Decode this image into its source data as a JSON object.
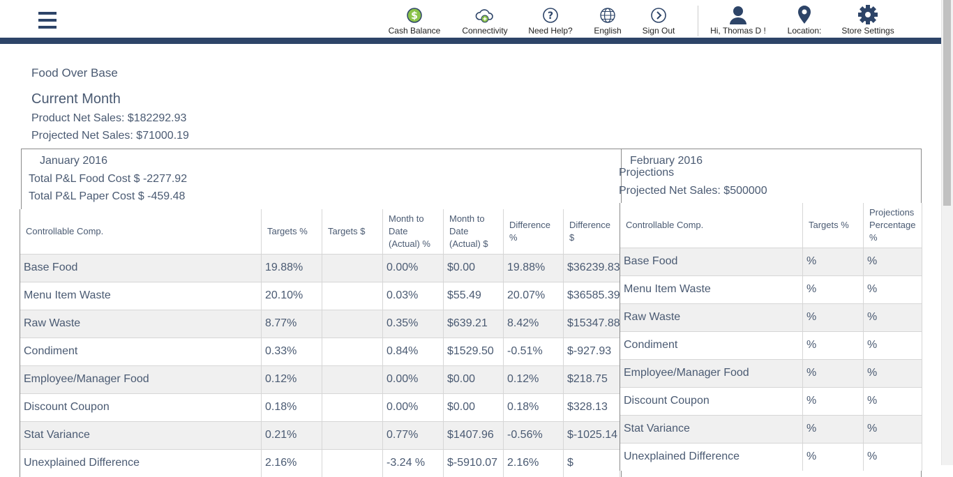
{
  "header": {
    "nav": [
      {
        "label": "Cash Balance",
        "icon": "dollar-circle-icon"
      },
      {
        "label": "Connectivity",
        "icon": "cloud-plus-icon"
      },
      {
        "label": "Need Help?",
        "icon": "question-circle-icon"
      },
      {
        "label": "English",
        "icon": "globe-icon"
      },
      {
        "label": "Sign Out",
        "icon": "chevron-right-circle-icon"
      },
      {
        "label": "Hi,  Thomas D !",
        "icon": "user-icon"
      },
      {
        "label": "Location:",
        "icon": "map-pin-icon"
      },
      {
        "label": "Store Settings",
        "icon": "gear-icon"
      }
    ],
    "accent": "#2d4468",
    "cash_icon_color": "#8bc34a"
  },
  "page": {
    "title": "Food Over Base",
    "period": "Current Month",
    "product_net_sales": "Product Net Sales: $182292.93",
    "projected_net_sales": "Projected Net Sales: $71000.19"
  },
  "left_panel": {
    "month": "January 2016",
    "food_cost": "Total P&L Food Cost $ -2277.92",
    "paper_cost": "Total P&L Paper Cost $ -459.48",
    "columns": [
      "Controllable Comp.",
      "Targets %",
      "Targets $",
      "Month to Date (Actual) %",
      "Month to Date (Actual) $",
      "Difference %",
      "Difference $"
    ],
    "rows": [
      [
        "Base Food",
        "19.88%",
        "",
        "0.00%",
        "$0.00",
        "19.88%",
        "$36239.83"
      ],
      [
        "Menu Item Waste",
        "20.10%",
        "",
        "0.03%",
        "$55.49",
        "20.07%",
        "$36585.39"
      ],
      [
        "Raw Waste",
        "8.77%",
        "",
        "0.35%",
        "$639.21",
        "8.42%",
        "$15347.88"
      ],
      [
        "Condiment",
        "0.33%",
        "",
        "0.84%",
        "$1529.50",
        "-0.51%",
        "$-927.93"
      ],
      [
        "Employee/Manager Food",
        "0.12%",
        "",
        "0.00%",
        "$0.00",
        "0.12%",
        "$218.75"
      ],
      [
        "Discount Coupon",
        "0.18%",
        "",
        "0.00%",
        "$0.00",
        "0.18%",
        "$328.13"
      ],
      [
        "Stat Variance",
        "0.21%",
        "",
        "0.77%",
        "$1407.96",
        "-0.56%",
        "$-1025.14"
      ],
      [
        "Unexplained Difference",
        "2.16%",
        "",
        "-3.24 %",
        "$-5910.07",
        "2.16%",
        "$"
      ]
    ]
  },
  "right_panel": {
    "month": "February 2016",
    "subtitle": "Projections",
    "projected_net_sales": "Projected Net Sales: $500000",
    "columns": [
      "Controllable Comp.",
      "Targets %",
      "Projections Percentage %"
    ],
    "rows": [
      [
        "Base Food",
        "%",
        "%"
      ],
      [
        "Menu Item Waste",
        "%",
        "%"
      ],
      [
        "Raw Waste",
        "%",
        "%"
      ],
      [
        "Condiment",
        "%",
        "%"
      ],
      [
        "Employee/Manager Food",
        "%",
        "%"
      ],
      [
        "Discount Coupon",
        "%",
        "%"
      ],
      [
        "Stat Variance",
        "%",
        "%"
      ],
      [
        "Unexplained Difference",
        "%",
        "%"
      ]
    ]
  }
}
